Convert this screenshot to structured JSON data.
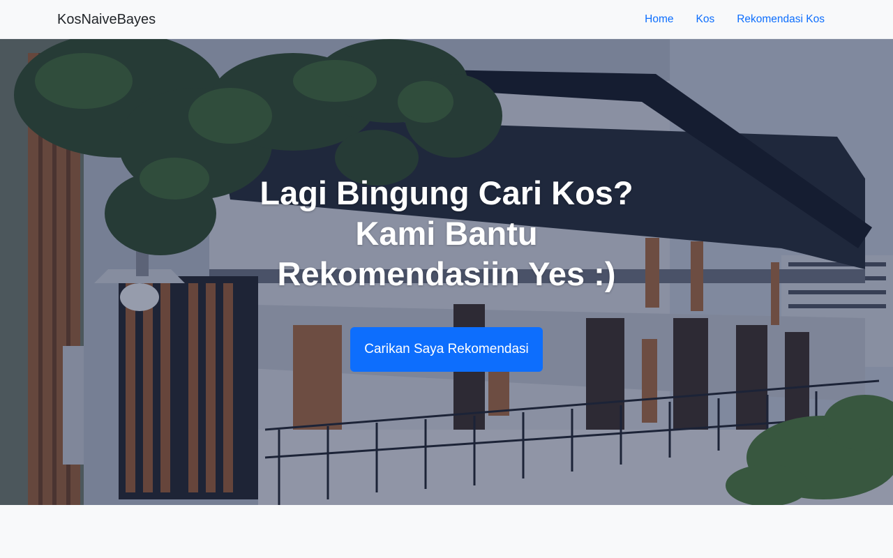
{
  "navbar": {
    "brand": "KosNaiveBayes",
    "links": [
      "Home",
      "Kos",
      "Rekomendasi Kos"
    ]
  },
  "hero": {
    "title_lines": [
      "Lagi Bingung Cari Kos?",
      "Kami Bantu",
      "Rekomendasiin Yes :)"
    ],
    "button_label": "Carikan Saya Rekomendasi"
  },
  "colors": {
    "primary": "#0d6efd",
    "navbar_bg": "#f8f9fa",
    "brand_text": "#212529",
    "hero_text": "#ffffff",
    "hero_overlay": "#1c2648"
  }
}
